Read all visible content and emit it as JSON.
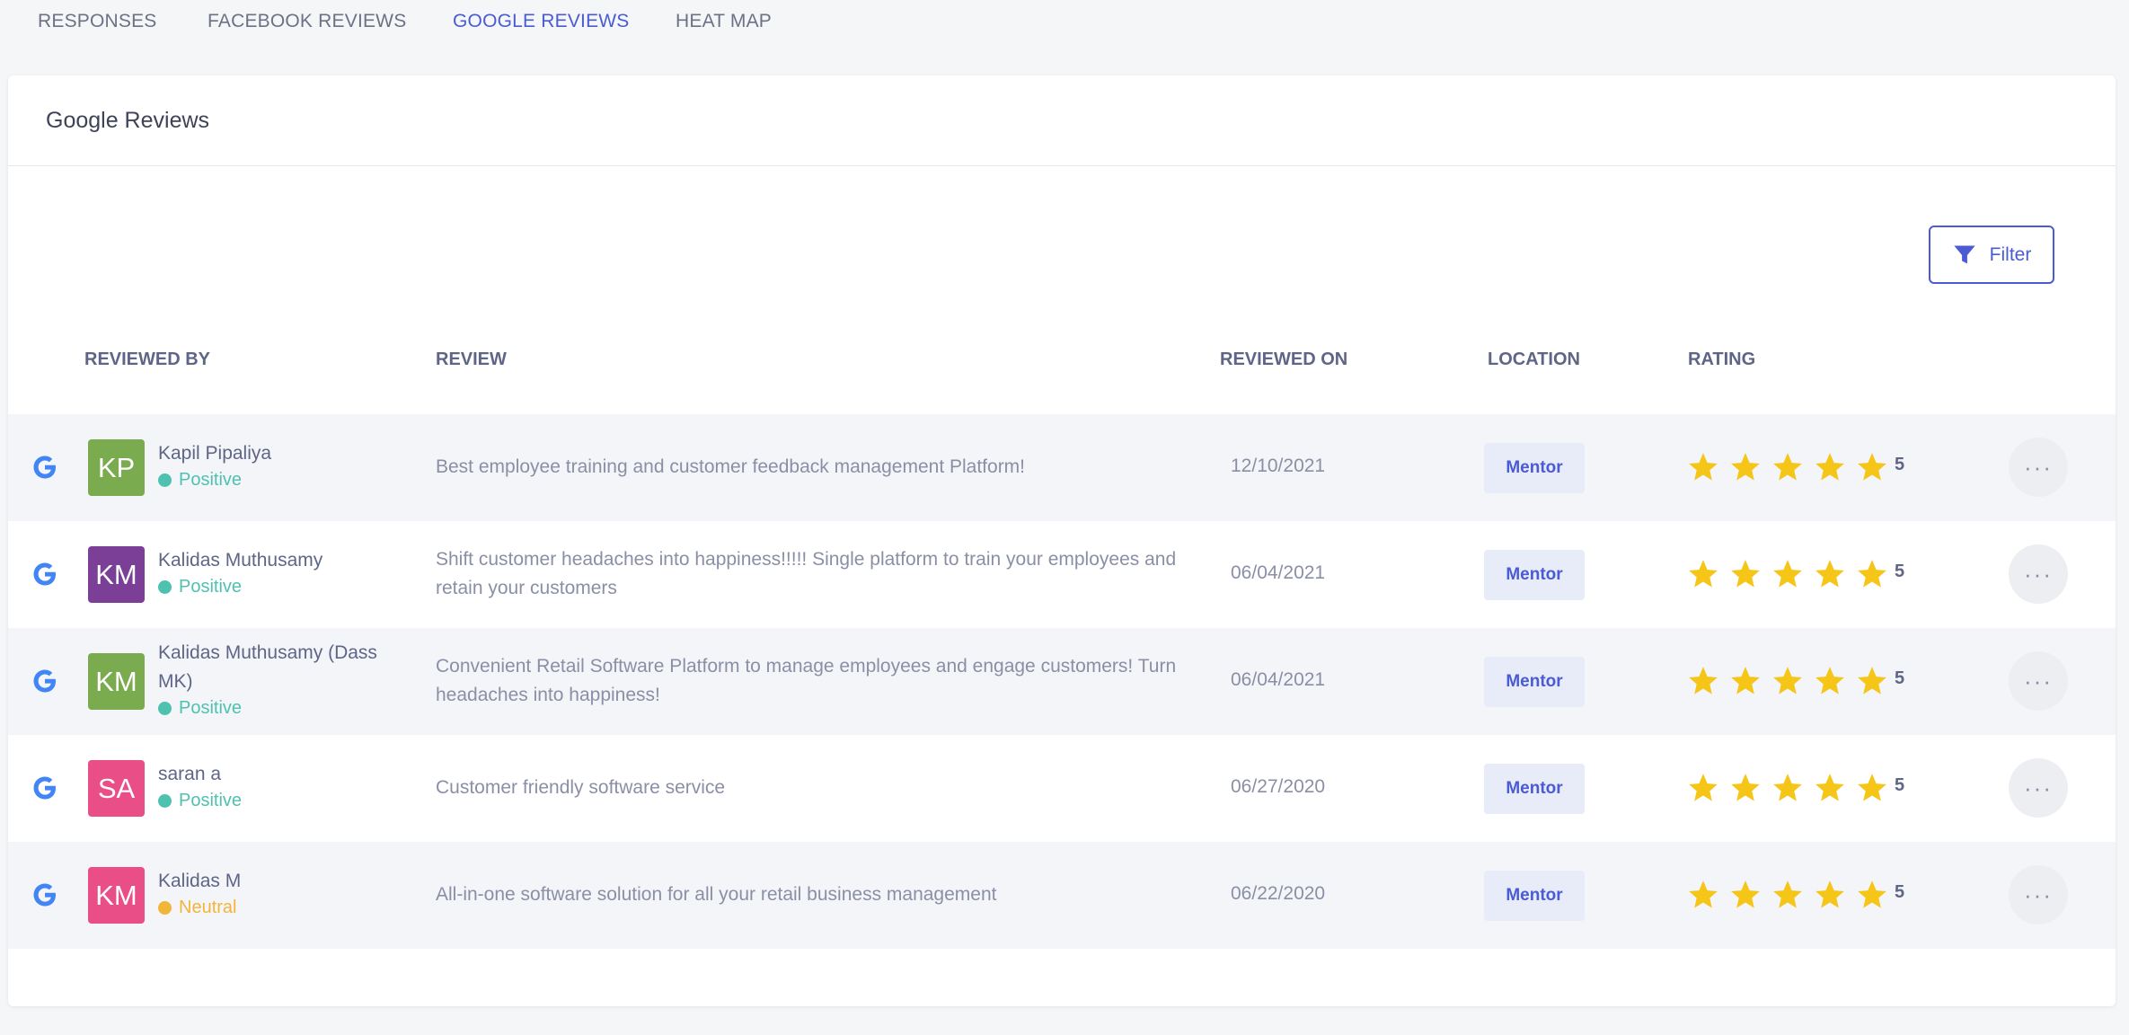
{
  "tabs": [
    {
      "label": "RESPONSES"
    },
    {
      "label": "FACEBOOK REVIEWS"
    },
    {
      "label": "GOOGLE REVIEWS"
    },
    {
      "label": "HEAT MAP"
    }
  ],
  "active_tab": "GOOGLE REVIEWS",
  "card": {
    "title": "Google Reviews"
  },
  "filter": {
    "label": "Filter",
    "icon": "funnel-icon"
  },
  "columns": {
    "reviewed_by": "REVIEWED BY",
    "review": "REVIEW",
    "reviewed_on": "REVIEWED ON",
    "location": "LOCATION",
    "rating": "RATING"
  },
  "colors": {
    "accent": "#4a5bd4",
    "positive": "#4fc1b0",
    "neutral": "#f2b53a",
    "star": "#f5c518"
  },
  "reviews": [
    {
      "source_icon": "google-icon",
      "initials": "KP",
      "avatar_color": "#7bab4f",
      "name": "Kapil Pipaliya",
      "sentiment": "Positive",
      "review": "Best employee training and customer feedback management Platform!",
      "date": "12/10/2021",
      "location": "Mentor",
      "stars": 5,
      "rating": "5"
    },
    {
      "source_icon": "google-icon",
      "initials": "KM",
      "avatar_color": "#7b3f98",
      "name": "Kalidas Muthusamy",
      "sentiment": "Positive",
      "review": "Shift customer headaches into happiness!!!!! Single platform to train your employees and retain your customers",
      "date": "06/04/2021",
      "location": "Mentor",
      "stars": 5,
      "rating": "5"
    },
    {
      "source_icon": "google-icon",
      "initials": "KM",
      "avatar_color": "#7bab4f",
      "name": "Kalidas Muthusamy (Dass MK)",
      "sentiment": "Positive",
      "review": "Convenient Retail Software Platform to manage employees and engage customers! Turn headaches into happiness!",
      "date": "06/04/2021",
      "location": "Mentor",
      "stars": 5,
      "rating": "5"
    },
    {
      "source_icon": "google-icon",
      "initials": "SA",
      "avatar_color": "#e94f86",
      "name": "saran a",
      "sentiment": "Positive",
      "review": "Customer friendly software service",
      "date": "06/27/2020",
      "location": "Mentor",
      "stars": 5,
      "rating": "5"
    },
    {
      "source_icon": "google-icon",
      "initials": "KM",
      "avatar_color": "#e94f86",
      "name": "Kalidas M",
      "sentiment": "Neutral",
      "review": "All-in-one software solution for all your retail business management",
      "date": "06/22/2020",
      "location": "Mentor",
      "stars": 5,
      "rating": "5"
    }
  ]
}
